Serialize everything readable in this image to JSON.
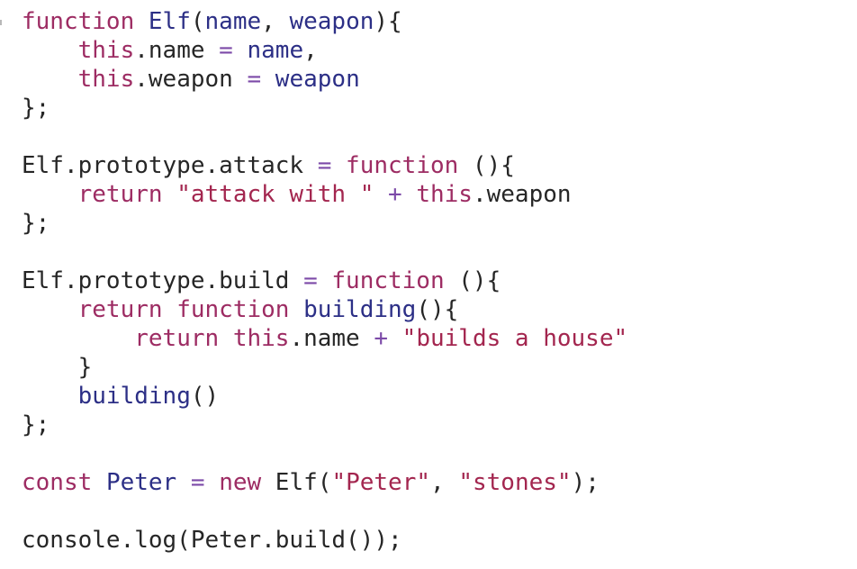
{
  "colors": {
    "keyword": "#9d2c63",
    "string": "#a3264f",
    "identifier": "#2c2f86",
    "plain": "#262626",
    "operator": "#7c4aa8",
    "background": "#ffffff"
  },
  "code": {
    "lines": [
      [
        {
          "t": "keyword",
          "v": "function"
        },
        {
          "t": "plain",
          "v": " "
        },
        {
          "t": "ident",
          "v": "Elf"
        },
        {
          "t": "plain",
          "v": "("
        },
        {
          "t": "ident",
          "v": "name"
        },
        {
          "t": "plain",
          "v": ", "
        },
        {
          "t": "ident",
          "v": "weapon"
        },
        {
          "t": "plain",
          "v": "){"
        }
      ],
      [
        {
          "t": "plain",
          "v": "    "
        },
        {
          "t": "keyword",
          "v": "this"
        },
        {
          "t": "plain",
          "v": ".name "
        },
        {
          "t": "op",
          "v": "="
        },
        {
          "t": "plain",
          "v": " "
        },
        {
          "t": "ident",
          "v": "name"
        },
        {
          "t": "plain",
          "v": ","
        }
      ],
      [
        {
          "t": "plain",
          "v": "    "
        },
        {
          "t": "keyword",
          "v": "this"
        },
        {
          "t": "plain",
          "v": ".weapon "
        },
        {
          "t": "op",
          "v": "="
        },
        {
          "t": "plain",
          "v": " "
        },
        {
          "t": "ident",
          "v": "weapon"
        }
      ],
      [
        {
          "t": "plain",
          "v": "};"
        }
      ],
      [],
      [
        {
          "t": "plain",
          "v": "Elf.prototype.attack "
        },
        {
          "t": "op",
          "v": "="
        },
        {
          "t": "plain",
          "v": " "
        },
        {
          "t": "keyword",
          "v": "function"
        },
        {
          "t": "plain",
          "v": " (){"
        }
      ],
      [
        {
          "t": "plain",
          "v": "    "
        },
        {
          "t": "keyword",
          "v": "return"
        },
        {
          "t": "plain",
          "v": " "
        },
        {
          "t": "string",
          "v": "\"attack with \""
        },
        {
          "t": "plain",
          "v": " "
        },
        {
          "t": "op",
          "v": "+"
        },
        {
          "t": "plain",
          "v": " "
        },
        {
          "t": "keyword",
          "v": "this"
        },
        {
          "t": "plain",
          "v": ".weapon"
        }
      ],
      [
        {
          "t": "plain",
          "v": "};"
        }
      ],
      [],
      [
        {
          "t": "plain",
          "v": "Elf.prototype.build "
        },
        {
          "t": "op",
          "v": "="
        },
        {
          "t": "plain",
          "v": " "
        },
        {
          "t": "keyword",
          "v": "function"
        },
        {
          "t": "plain",
          "v": " (){"
        }
      ],
      [
        {
          "t": "plain",
          "v": "    "
        },
        {
          "t": "keyword",
          "v": "return"
        },
        {
          "t": "plain",
          "v": " "
        },
        {
          "t": "keyword",
          "v": "function"
        },
        {
          "t": "plain",
          "v": " "
        },
        {
          "t": "ident",
          "v": "building"
        },
        {
          "t": "plain",
          "v": "(){"
        }
      ],
      [
        {
          "t": "plain",
          "v": "        "
        },
        {
          "t": "keyword",
          "v": "return"
        },
        {
          "t": "plain",
          "v": " "
        },
        {
          "t": "keyword",
          "v": "this"
        },
        {
          "t": "plain",
          "v": ".name "
        },
        {
          "t": "op",
          "v": "+"
        },
        {
          "t": "plain",
          "v": " "
        },
        {
          "t": "string",
          "v": "\"builds a house\""
        }
      ],
      [
        {
          "t": "plain",
          "v": "    }"
        }
      ],
      [
        {
          "t": "plain",
          "v": "    "
        },
        {
          "t": "ident",
          "v": "building"
        },
        {
          "t": "plain",
          "v": "()"
        }
      ],
      [
        {
          "t": "plain",
          "v": "};"
        }
      ],
      [],
      [
        {
          "t": "keyword",
          "v": "const"
        },
        {
          "t": "plain",
          "v": " "
        },
        {
          "t": "ident",
          "v": "Peter"
        },
        {
          "t": "plain",
          "v": " "
        },
        {
          "t": "op",
          "v": "="
        },
        {
          "t": "plain",
          "v": " "
        },
        {
          "t": "keyword",
          "v": "new"
        },
        {
          "t": "plain",
          "v": " Elf("
        },
        {
          "t": "string",
          "v": "\"Peter\""
        },
        {
          "t": "plain",
          "v": ", "
        },
        {
          "t": "string",
          "v": "\"stones\""
        },
        {
          "t": "plain",
          "v": ");"
        }
      ],
      [],
      [
        {
          "t": "plain",
          "v": "console.log(Peter.build());"
        }
      ]
    ]
  }
}
